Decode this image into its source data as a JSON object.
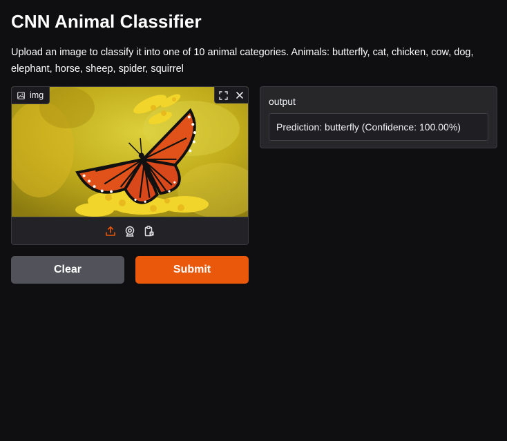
{
  "app": {
    "title": "CNN Animal Classifier",
    "description": "Upload an image to classify it into one of 10 animal categories. Animals: butterfly, cat, chicken, cow, dog, elephant, horse, sheep, spider, squirrel"
  },
  "image_input": {
    "label": "img",
    "icon": "image-icon",
    "toolbar": [
      "fullscreen-icon",
      "close-icon"
    ],
    "sources": [
      "upload-icon",
      "webcam-icon",
      "clipboard-icon"
    ]
  },
  "buttons": {
    "clear_label": "Clear",
    "submit_label": "Submit"
  },
  "output": {
    "label": "output",
    "value": "Prediction: butterfly (Confidence: 100.00%)"
  },
  "colors": {
    "background": "#0f0f11",
    "primary": "#ea580c",
    "secondary": "#52525b",
    "panel": "#27272a"
  }
}
